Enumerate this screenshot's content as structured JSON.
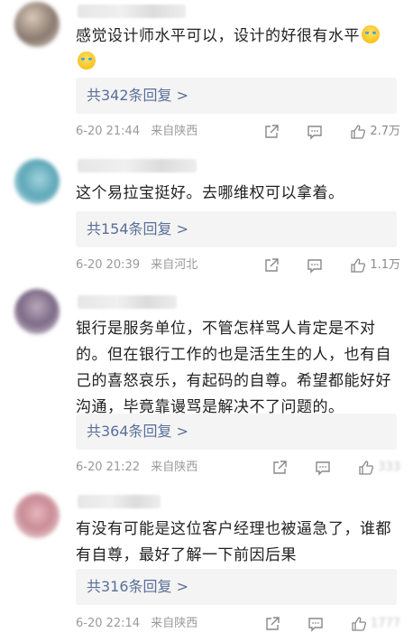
{
  "comments": [
    {
      "text": "感觉设计师水平可以，设计的好很有水平",
      "replies": "共342条回复 >",
      "time": "6-20 21:44",
      "location": "来自陕西",
      "likes": "2.7万"
    },
    {
      "text": "这个易拉宝挺好。去哪维权可以拿着。",
      "replies": "共154条回复 >",
      "time": "6-20 20:39",
      "location": "来自河北",
      "likes": "1.1万"
    },
    {
      "text": "银行是服务单位，不管怎样骂人肯定是不对的。但在银行工作的也是活生生的人，也有自己的喜怒哀乐，有起码的自尊。希望都能好好沟通，毕竟靠谩骂是解决不了问题的。",
      "replies": "共364条回复 >",
      "time": "6-20 21:22",
      "location": "来自陕西",
      "likes": "333"
    },
    {
      "text": "有没有可能是这位客户经理也被逼急了，谁都有自尊，最好了解一下前因后果",
      "replies": "共316条回复 >",
      "time": "6-20 22:14",
      "location": "来自陕西",
      "likes": "1777"
    }
  ],
  "icons": [
    "share-icon",
    "comment-icon",
    "like-icon"
  ],
  "colors": {
    "reply_link": "#5a6f9a",
    "reply_bg": "#f4f4f4",
    "meta": "#9a9a9a"
  }
}
